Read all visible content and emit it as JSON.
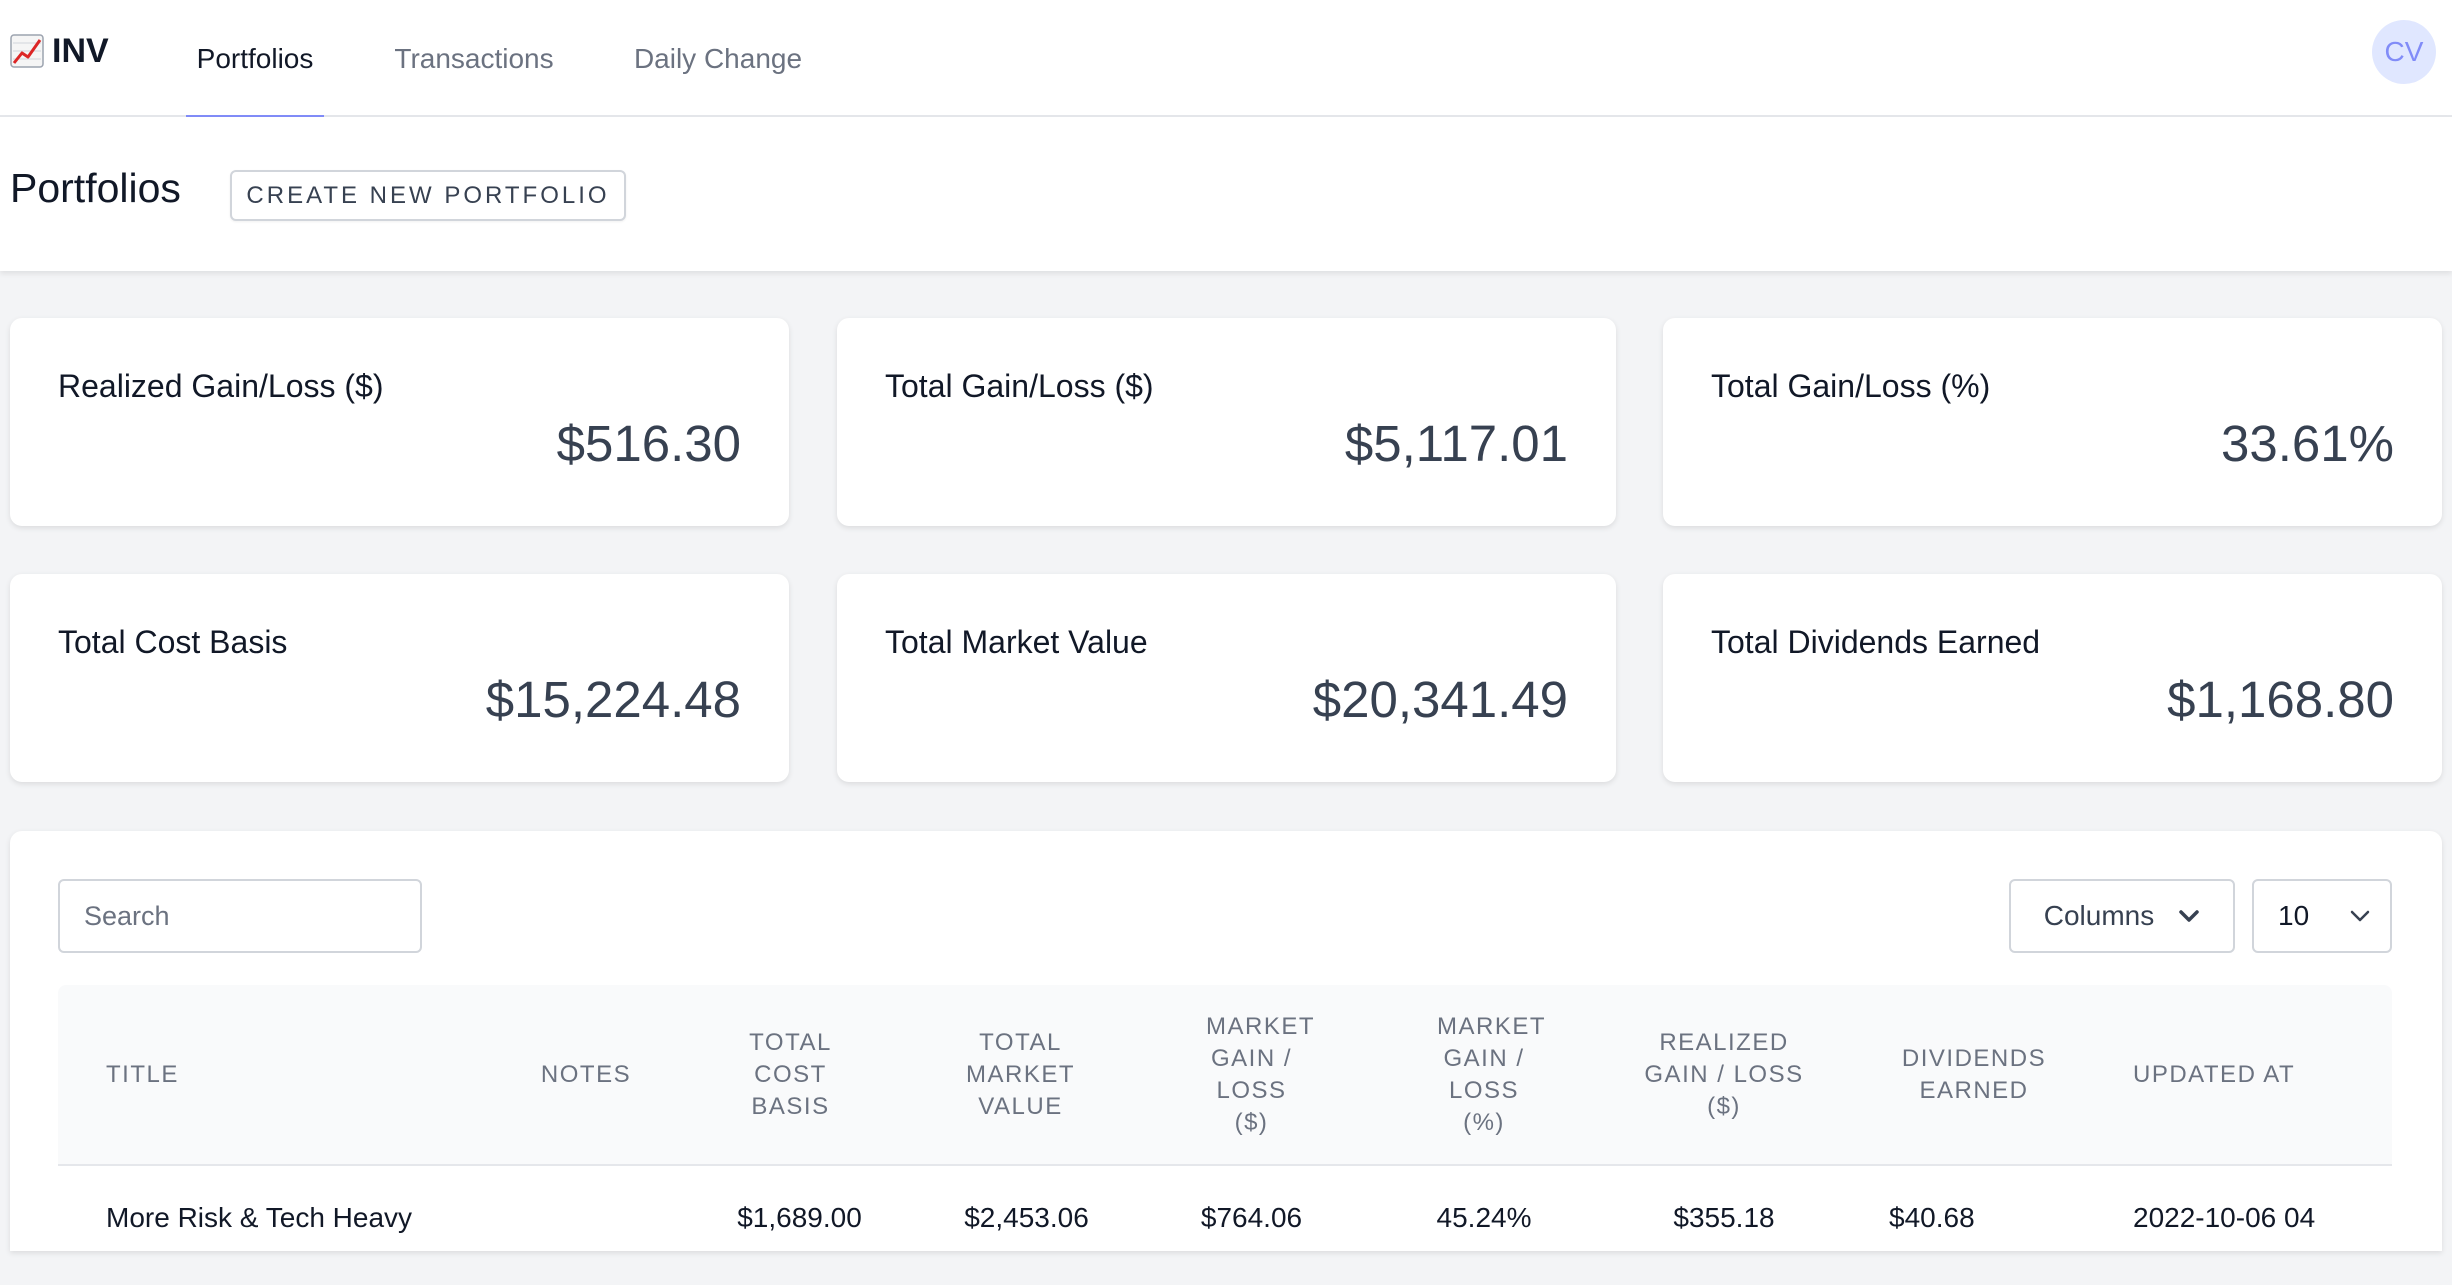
{
  "app": {
    "brand_icon": "chart-increasing-icon",
    "brand_name": "INV"
  },
  "nav": {
    "tabs": [
      {
        "label": "Portfolios",
        "active": true
      },
      {
        "label": "Transactions",
        "active": false
      },
      {
        "label": "Daily Change",
        "active": false
      }
    ],
    "avatar_initials": "CV"
  },
  "header": {
    "title": "Portfolios",
    "create_button": "CREATE NEW PORTFOLIO"
  },
  "stats": [
    {
      "label": "Realized Gain/Loss ($)",
      "value": "$516.30"
    },
    {
      "label": "Total Gain/Loss ($)",
      "value": "$5,117.01"
    },
    {
      "label": "Total Gain/Loss (%)",
      "value": "33.61%"
    },
    {
      "label": "Total Cost Basis",
      "value": "$15,224.48"
    },
    {
      "label": "Total Market Value",
      "value": "$20,341.49"
    },
    {
      "label": "Total Dividends Earned",
      "value": "$1,168.80"
    }
  ],
  "table_controls": {
    "search_placeholder": "Search",
    "columns_label": "Columns",
    "page_size": "10"
  },
  "table": {
    "headers": [
      "Title",
      "Notes",
      "Total Cost Basis",
      "Total Market Value",
      "Market Gain / Loss ($)",
      "Market Gain / Loss (%)",
      "Realized Gain / Loss ($)",
      "Dividends Earned",
      "Updated At"
    ],
    "rows": [
      {
        "title": "More Risk & Tech Heavy",
        "notes": "",
        "total_cost_basis": "$1,689.00",
        "total_market_value": "$2,453.06",
        "market_gain_loss_usd": "$764.06",
        "market_gain_loss_pct": "45.24%",
        "realized_gain_loss": "$355.18",
        "dividends_earned": "$40.68",
        "updated_at": "2022-10-06 04"
      }
    ]
  },
  "colors": {
    "accent": "#818cf8",
    "avatar_bg": "#e0e7ff",
    "page_bg": "#f3f4f6",
    "value_text": "#374151",
    "muted_text": "#6b7280"
  }
}
